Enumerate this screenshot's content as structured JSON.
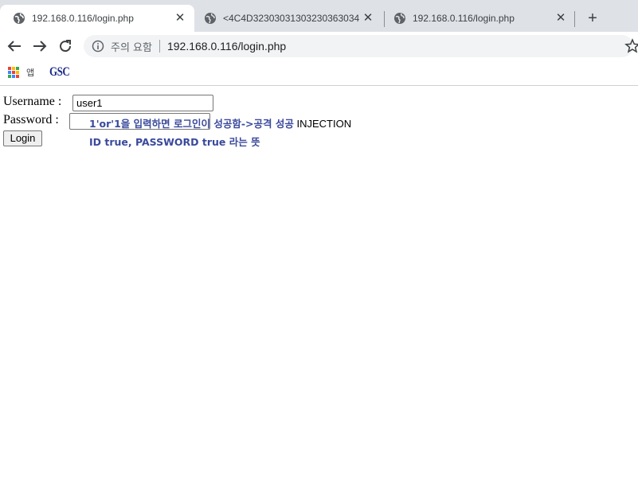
{
  "browser": {
    "tabs": [
      {
        "title": "192.168.0.116/login.php",
        "active": true,
        "icon": "globe-icon"
      },
      {
        "title": "<4C4D32303031303230363034",
        "active": false,
        "icon": "globe-icon"
      },
      {
        "title": "192.168.0.116/login.php",
        "active": false,
        "icon": "globe-icon"
      }
    ],
    "new_tab_label": "+",
    "close_glyph": "✕",
    "address_bar": {
      "security_warning": "주의 요함",
      "url": "192.168.0.116/login.php"
    },
    "bookmarks": {
      "apps_label": "앱",
      "apps_colors": [
        "#ea4335",
        "#fbbc05",
        "#34a853",
        "#4285f4",
        "#ea4335",
        "#fbbc05",
        "#34a853",
        "#4285f4",
        "#ea4335"
      ],
      "gsc_label": "GSC"
    }
  },
  "form": {
    "username_label": "Username :",
    "username_value": "user1",
    "password_label": "Password :",
    "password_value": "",
    "login_button": "Login"
  },
  "annotation": {
    "line1_bold": "1'or'1을 입력하면 로그인이 성공함->공격 성공",
    "line1_plain": " INJECTION",
    "line2": "ID true, PASSWORD true 라는 뜻"
  }
}
